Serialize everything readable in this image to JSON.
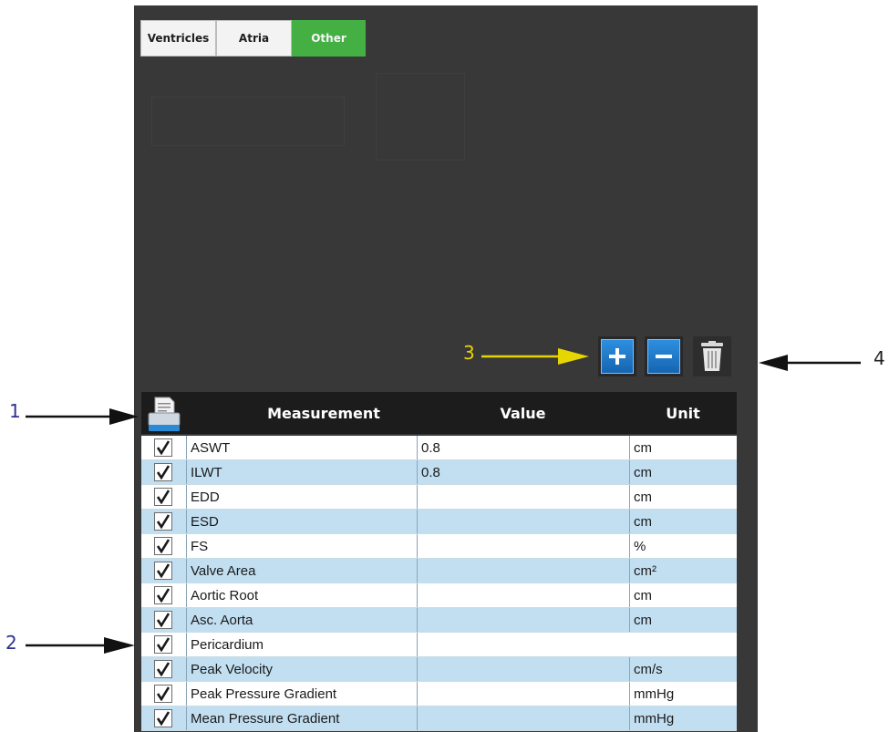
{
  "tabs": [
    {
      "label": "Ventricles",
      "active": false
    },
    {
      "label": "Atria",
      "active": false
    },
    {
      "label": "Other",
      "active": true
    }
  ],
  "toolbar": {
    "add_icon": "plus-icon",
    "remove_icon": "minus-icon",
    "delete_icon": "trash-icon"
  },
  "table": {
    "print_icon": "print-report-icon",
    "headers": {
      "measurement": "Measurement",
      "value": "Value",
      "unit": "Unit"
    },
    "rows": [
      {
        "checked": true,
        "name": "ASWT",
        "value": "0.8",
        "unit": "cm"
      },
      {
        "checked": true,
        "name": "ILWT",
        "value": "0.8",
        "unit": "cm"
      },
      {
        "checked": true,
        "name": "EDD",
        "value": "",
        "unit": "cm"
      },
      {
        "checked": true,
        "name": "ESD",
        "value": "",
        "unit": "cm"
      },
      {
        "checked": true,
        "name": "FS",
        "value": "",
        "unit": "%"
      },
      {
        "checked": true,
        "name": "Valve Area",
        "value": "",
        "unit": "cm²"
      },
      {
        "checked": true,
        "name": "Aortic Root",
        "value": "",
        "unit": "cm"
      },
      {
        "checked": true,
        "name": "Asc. Aorta",
        "value": "",
        "unit": "cm"
      },
      {
        "checked": true,
        "name": "Pericardium",
        "value": "",
        "unit": ""
      },
      {
        "checked": true,
        "name": "Peak Velocity",
        "value": "",
        "unit": "cm/s"
      },
      {
        "checked": true,
        "name": "Peak Pressure Gradient",
        "value": "",
        "unit": "mmHg"
      },
      {
        "checked": true,
        "name": "Mean Pressure Gradient",
        "value": "",
        "unit": "mmHg"
      }
    ]
  },
  "callouts": [
    {
      "label": "1",
      "color": "#2e3192"
    },
    {
      "label": "2",
      "color": "#2e3192"
    },
    {
      "label": "3",
      "color": "#e6d600"
    },
    {
      "label": "4",
      "color": "#231f20"
    }
  ],
  "colors": {
    "panel_bg": "#383838",
    "active_tab": "#44b044",
    "row_alt": "#c2dff2",
    "button_blue": "#1f7acb"
  }
}
